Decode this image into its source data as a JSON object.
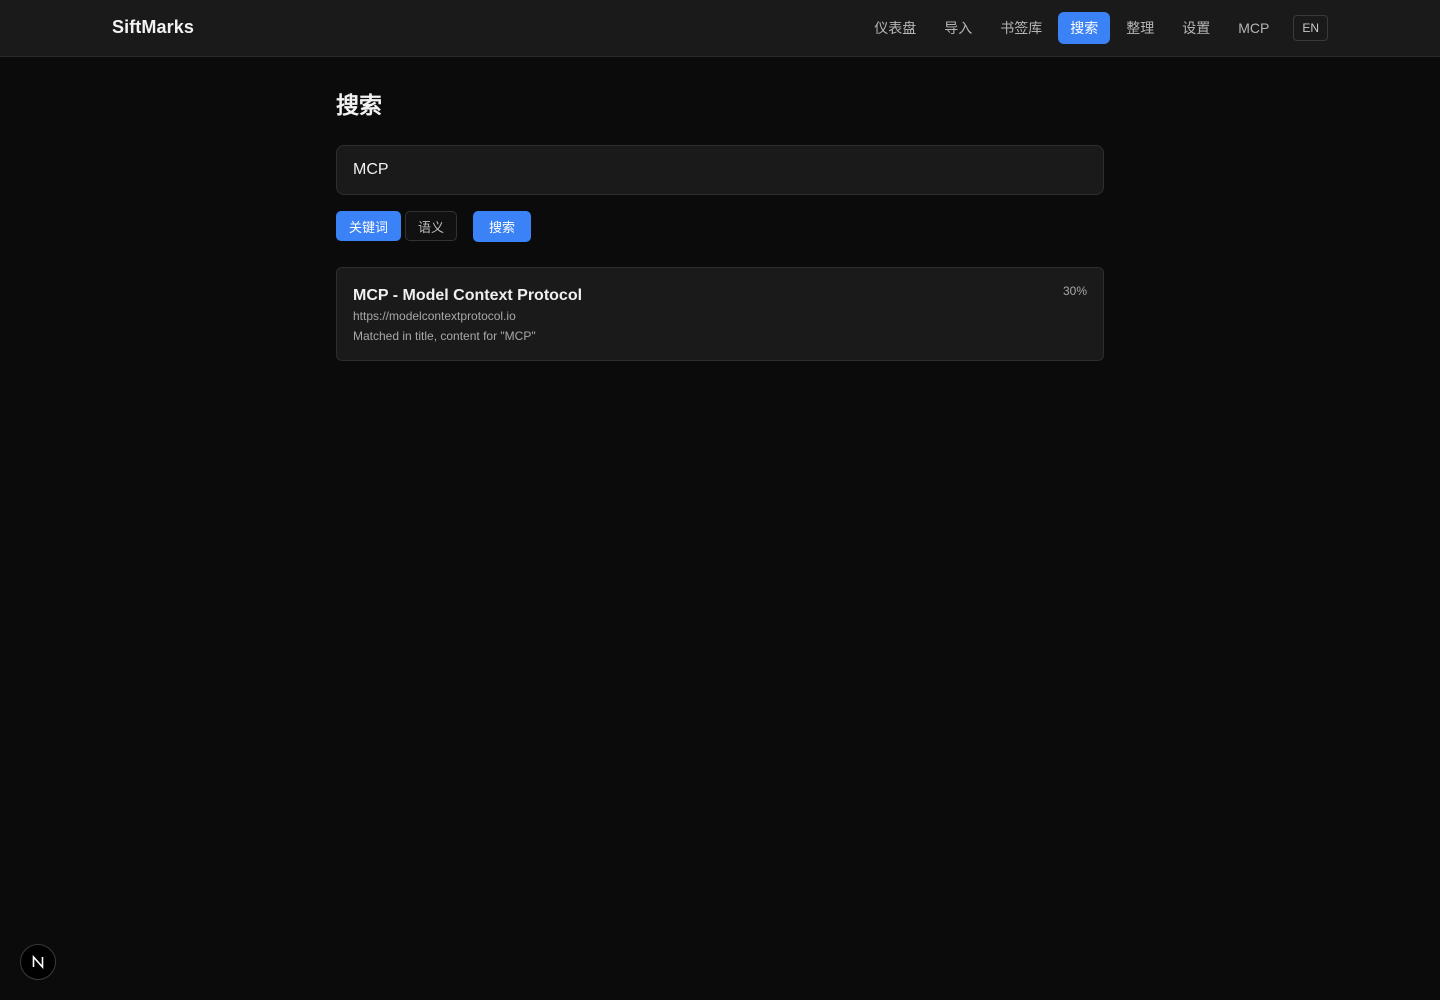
{
  "app": {
    "brand": "SiftMarks"
  },
  "nav": {
    "items": [
      {
        "label": "仪表盘",
        "active": false
      },
      {
        "label": "导入",
        "active": false
      },
      {
        "label": "书签库",
        "active": false
      },
      {
        "label": "搜索",
        "active": true
      },
      {
        "label": "整理",
        "active": false
      },
      {
        "label": "设置",
        "active": false
      },
      {
        "label": "MCP",
        "active": false
      }
    ],
    "language_toggle": "EN"
  },
  "page": {
    "title": "搜索"
  },
  "search": {
    "query": "MCP",
    "modes": [
      {
        "label": "关键词",
        "selected": true
      },
      {
        "label": "语义",
        "selected": false
      }
    ],
    "submit_label": "搜索"
  },
  "results": [
    {
      "title": "MCP - Model Context Protocol",
      "url": "https://modelcontextprotocol.io",
      "match_info": "Matched in title, content for \"MCP\"",
      "score": "30%"
    }
  ],
  "dev_indicator": {
    "icon": "next-logo-icon"
  },
  "colors": {
    "background": "#0b0b0b",
    "surface": "#1a1a1a",
    "accent": "#3b82f6",
    "border": "#2e2e2e"
  }
}
